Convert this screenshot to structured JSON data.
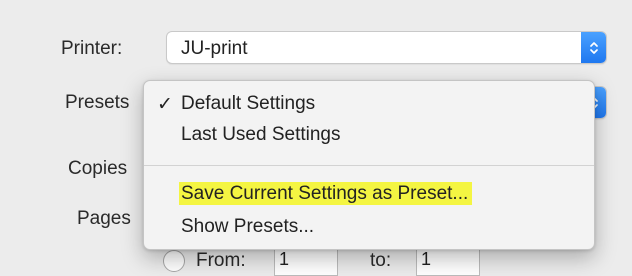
{
  "print_dialog": {
    "printer": {
      "label": "Printer:",
      "value": "JU-print"
    },
    "presets": {
      "label": "Presets"
    },
    "copies": {
      "label": "Copies"
    },
    "pages": {
      "label": "Pages",
      "from_label": "From:",
      "from_value": "1",
      "to_label": "to:",
      "to_value": "1"
    }
  },
  "presets_menu": {
    "checkmark": "✓",
    "items": [
      {
        "label": "Default Settings",
        "checked": true
      },
      {
        "label": "Last Used Settings",
        "checked": false
      },
      {
        "label": "Save Current Settings as Preset...",
        "highlight": true
      },
      {
        "label": "Show Presets...",
        "checked": false
      }
    ]
  },
  "colors": {
    "accent": "#1f78f0",
    "highlight": "#f4f542",
    "background": "#ececec"
  },
  "icons": {
    "popup_stepper": "up-down-chevron-icon"
  }
}
